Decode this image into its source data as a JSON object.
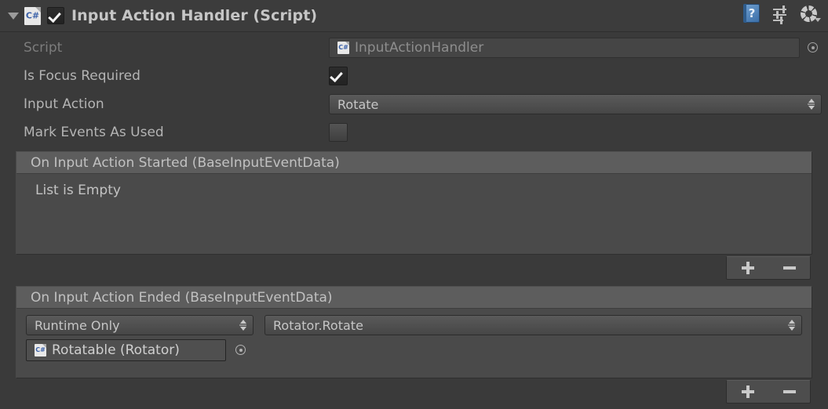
{
  "component": {
    "title": "Input Action Handler (Script)",
    "enabled_checkbox": true,
    "foldout_expanded": true,
    "script_icon_label": "C#",
    "header_icons": [
      {
        "name": "help-icon",
        "glyph": "?"
      },
      {
        "name": "preset-icon",
        "glyph": ""
      },
      {
        "name": "gear-icon",
        "glyph": ""
      }
    ]
  },
  "properties": {
    "script": {
      "label": "Script",
      "value": "InputActionHandler",
      "icon_label": "C#"
    },
    "is_focus_required": {
      "label": "Is Focus Required",
      "checked": true
    },
    "input_action": {
      "label": "Input Action",
      "value": "Rotate"
    },
    "mark_events_as_used": {
      "label": "Mark Events As Used",
      "checked": false
    }
  },
  "events": [
    {
      "header": "On Input Action Started (BaseInputEventData)",
      "empty_text": "List is Empty",
      "entries": [],
      "add_label": "+",
      "remove_label": "−"
    },
    {
      "header": "On Input Action Ended (BaseInputEventData)",
      "empty_text": "",
      "entries": [
        {
          "mode": "Runtime Only",
          "method": "Rotator.Rotate",
          "target": "Rotatable (Rotator)",
          "target_icon_label": "C#"
        }
      ],
      "add_label": "+",
      "remove_label": "−"
    }
  ],
  "colors": {
    "panel_bg": "#3a3a3a",
    "header_bg": "#3c3c3c",
    "list_bg": "#4a4a4a",
    "section_header_bg": "#5d5d5d",
    "text": "#b4b4b4",
    "text_dim": "#7c7c7c",
    "accent_blue": "#3b6fa8"
  }
}
